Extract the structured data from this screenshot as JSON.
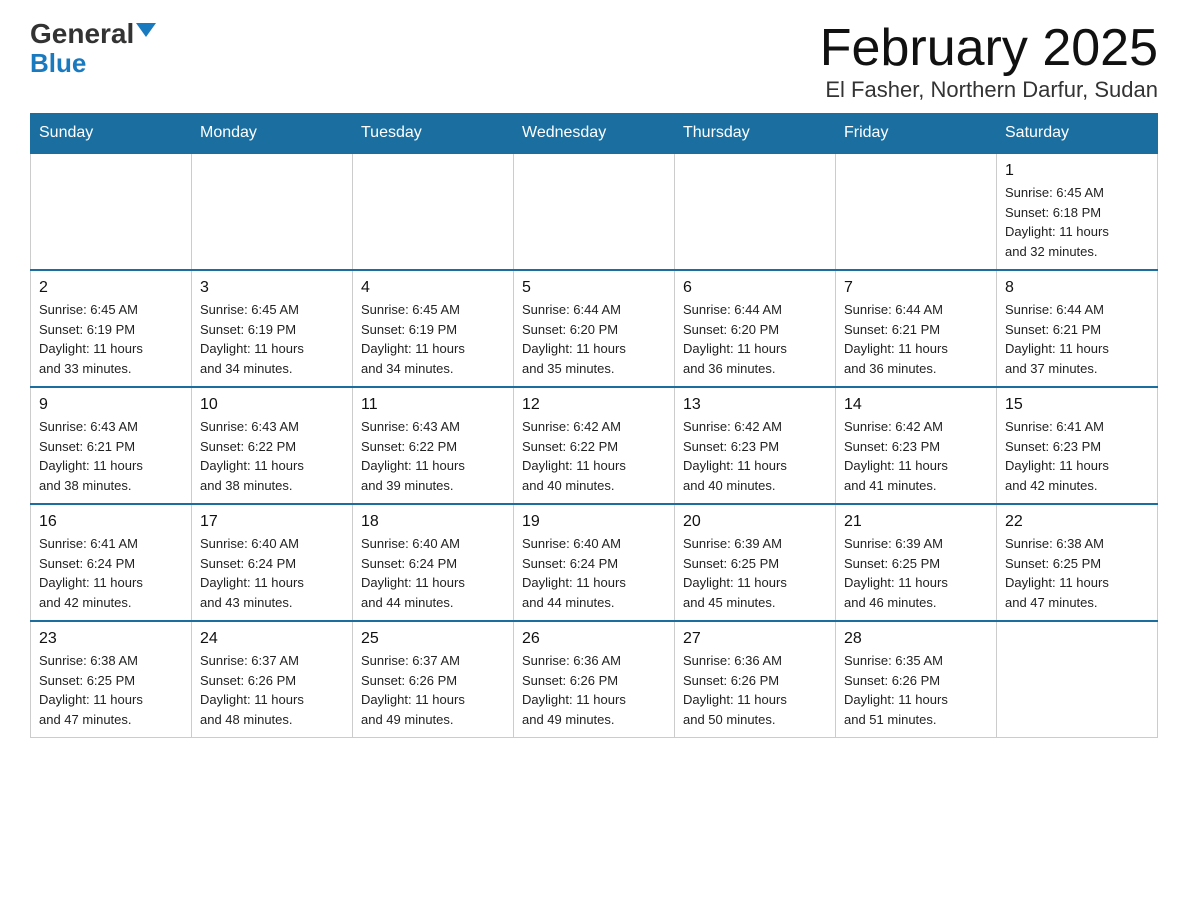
{
  "logo": {
    "general": "General",
    "blue": "Blue"
  },
  "title": "February 2025",
  "subtitle": "El Fasher, Northern Darfur, Sudan",
  "days_of_week": [
    "Sunday",
    "Monday",
    "Tuesday",
    "Wednesday",
    "Thursday",
    "Friday",
    "Saturday"
  ],
  "weeks": [
    [
      {
        "day": "",
        "info": ""
      },
      {
        "day": "",
        "info": ""
      },
      {
        "day": "",
        "info": ""
      },
      {
        "day": "",
        "info": ""
      },
      {
        "day": "",
        "info": ""
      },
      {
        "day": "",
        "info": ""
      },
      {
        "day": "1",
        "info": "Sunrise: 6:45 AM\nSunset: 6:18 PM\nDaylight: 11 hours\nand 32 minutes."
      }
    ],
    [
      {
        "day": "2",
        "info": "Sunrise: 6:45 AM\nSunset: 6:19 PM\nDaylight: 11 hours\nand 33 minutes."
      },
      {
        "day": "3",
        "info": "Sunrise: 6:45 AM\nSunset: 6:19 PM\nDaylight: 11 hours\nand 34 minutes."
      },
      {
        "day": "4",
        "info": "Sunrise: 6:45 AM\nSunset: 6:19 PM\nDaylight: 11 hours\nand 34 minutes."
      },
      {
        "day": "5",
        "info": "Sunrise: 6:44 AM\nSunset: 6:20 PM\nDaylight: 11 hours\nand 35 minutes."
      },
      {
        "day": "6",
        "info": "Sunrise: 6:44 AM\nSunset: 6:20 PM\nDaylight: 11 hours\nand 36 minutes."
      },
      {
        "day": "7",
        "info": "Sunrise: 6:44 AM\nSunset: 6:21 PM\nDaylight: 11 hours\nand 36 minutes."
      },
      {
        "day": "8",
        "info": "Sunrise: 6:44 AM\nSunset: 6:21 PM\nDaylight: 11 hours\nand 37 minutes."
      }
    ],
    [
      {
        "day": "9",
        "info": "Sunrise: 6:43 AM\nSunset: 6:21 PM\nDaylight: 11 hours\nand 38 minutes."
      },
      {
        "day": "10",
        "info": "Sunrise: 6:43 AM\nSunset: 6:22 PM\nDaylight: 11 hours\nand 38 minutes."
      },
      {
        "day": "11",
        "info": "Sunrise: 6:43 AM\nSunset: 6:22 PM\nDaylight: 11 hours\nand 39 minutes."
      },
      {
        "day": "12",
        "info": "Sunrise: 6:42 AM\nSunset: 6:22 PM\nDaylight: 11 hours\nand 40 minutes."
      },
      {
        "day": "13",
        "info": "Sunrise: 6:42 AM\nSunset: 6:23 PM\nDaylight: 11 hours\nand 40 minutes."
      },
      {
        "day": "14",
        "info": "Sunrise: 6:42 AM\nSunset: 6:23 PM\nDaylight: 11 hours\nand 41 minutes."
      },
      {
        "day": "15",
        "info": "Sunrise: 6:41 AM\nSunset: 6:23 PM\nDaylight: 11 hours\nand 42 minutes."
      }
    ],
    [
      {
        "day": "16",
        "info": "Sunrise: 6:41 AM\nSunset: 6:24 PM\nDaylight: 11 hours\nand 42 minutes."
      },
      {
        "day": "17",
        "info": "Sunrise: 6:40 AM\nSunset: 6:24 PM\nDaylight: 11 hours\nand 43 minutes."
      },
      {
        "day": "18",
        "info": "Sunrise: 6:40 AM\nSunset: 6:24 PM\nDaylight: 11 hours\nand 44 minutes."
      },
      {
        "day": "19",
        "info": "Sunrise: 6:40 AM\nSunset: 6:24 PM\nDaylight: 11 hours\nand 44 minutes."
      },
      {
        "day": "20",
        "info": "Sunrise: 6:39 AM\nSunset: 6:25 PM\nDaylight: 11 hours\nand 45 minutes."
      },
      {
        "day": "21",
        "info": "Sunrise: 6:39 AM\nSunset: 6:25 PM\nDaylight: 11 hours\nand 46 minutes."
      },
      {
        "day": "22",
        "info": "Sunrise: 6:38 AM\nSunset: 6:25 PM\nDaylight: 11 hours\nand 47 minutes."
      }
    ],
    [
      {
        "day": "23",
        "info": "Sunrise: 6:38 AM\nSunset: 6:25 PM\nDaylight: 11 hours\nand 47 minutes."
      },
      {
        "day": "24",
        "info": "Sunrise: 6:37 AM\nSunset: 6:26 PM\nDaylight: 11 hours\nand 48 minutes."
      },
      {
        "day": "25",
        "info": "Sunrise: 6:37 AM\nSunset: 6:26 PM\nDaylight: 11 hours\nand 49 minutes."
      },
      {
        "day": "26",
        "info": "Sunrise: 6:36 AM\nSunset: 6:26 PM\nDaylight: 11 hours\nand 49 minutes."
      },
      {
        "day": "27",
        "info": "Sunrise: 6:36 AM\nSunset: 6:26 PM\nDaylight: 11 hours\nand 50 minutes."
      },
      {
        "day": "28",
        "info": "Sunrise: 6:35 AM\nSunset: 6:26 PM\nDaylight: 11 hours\nand 51 minutes."
      },
      {
        "day": "",
        "info": ""
      }
    ]
  ]
}
